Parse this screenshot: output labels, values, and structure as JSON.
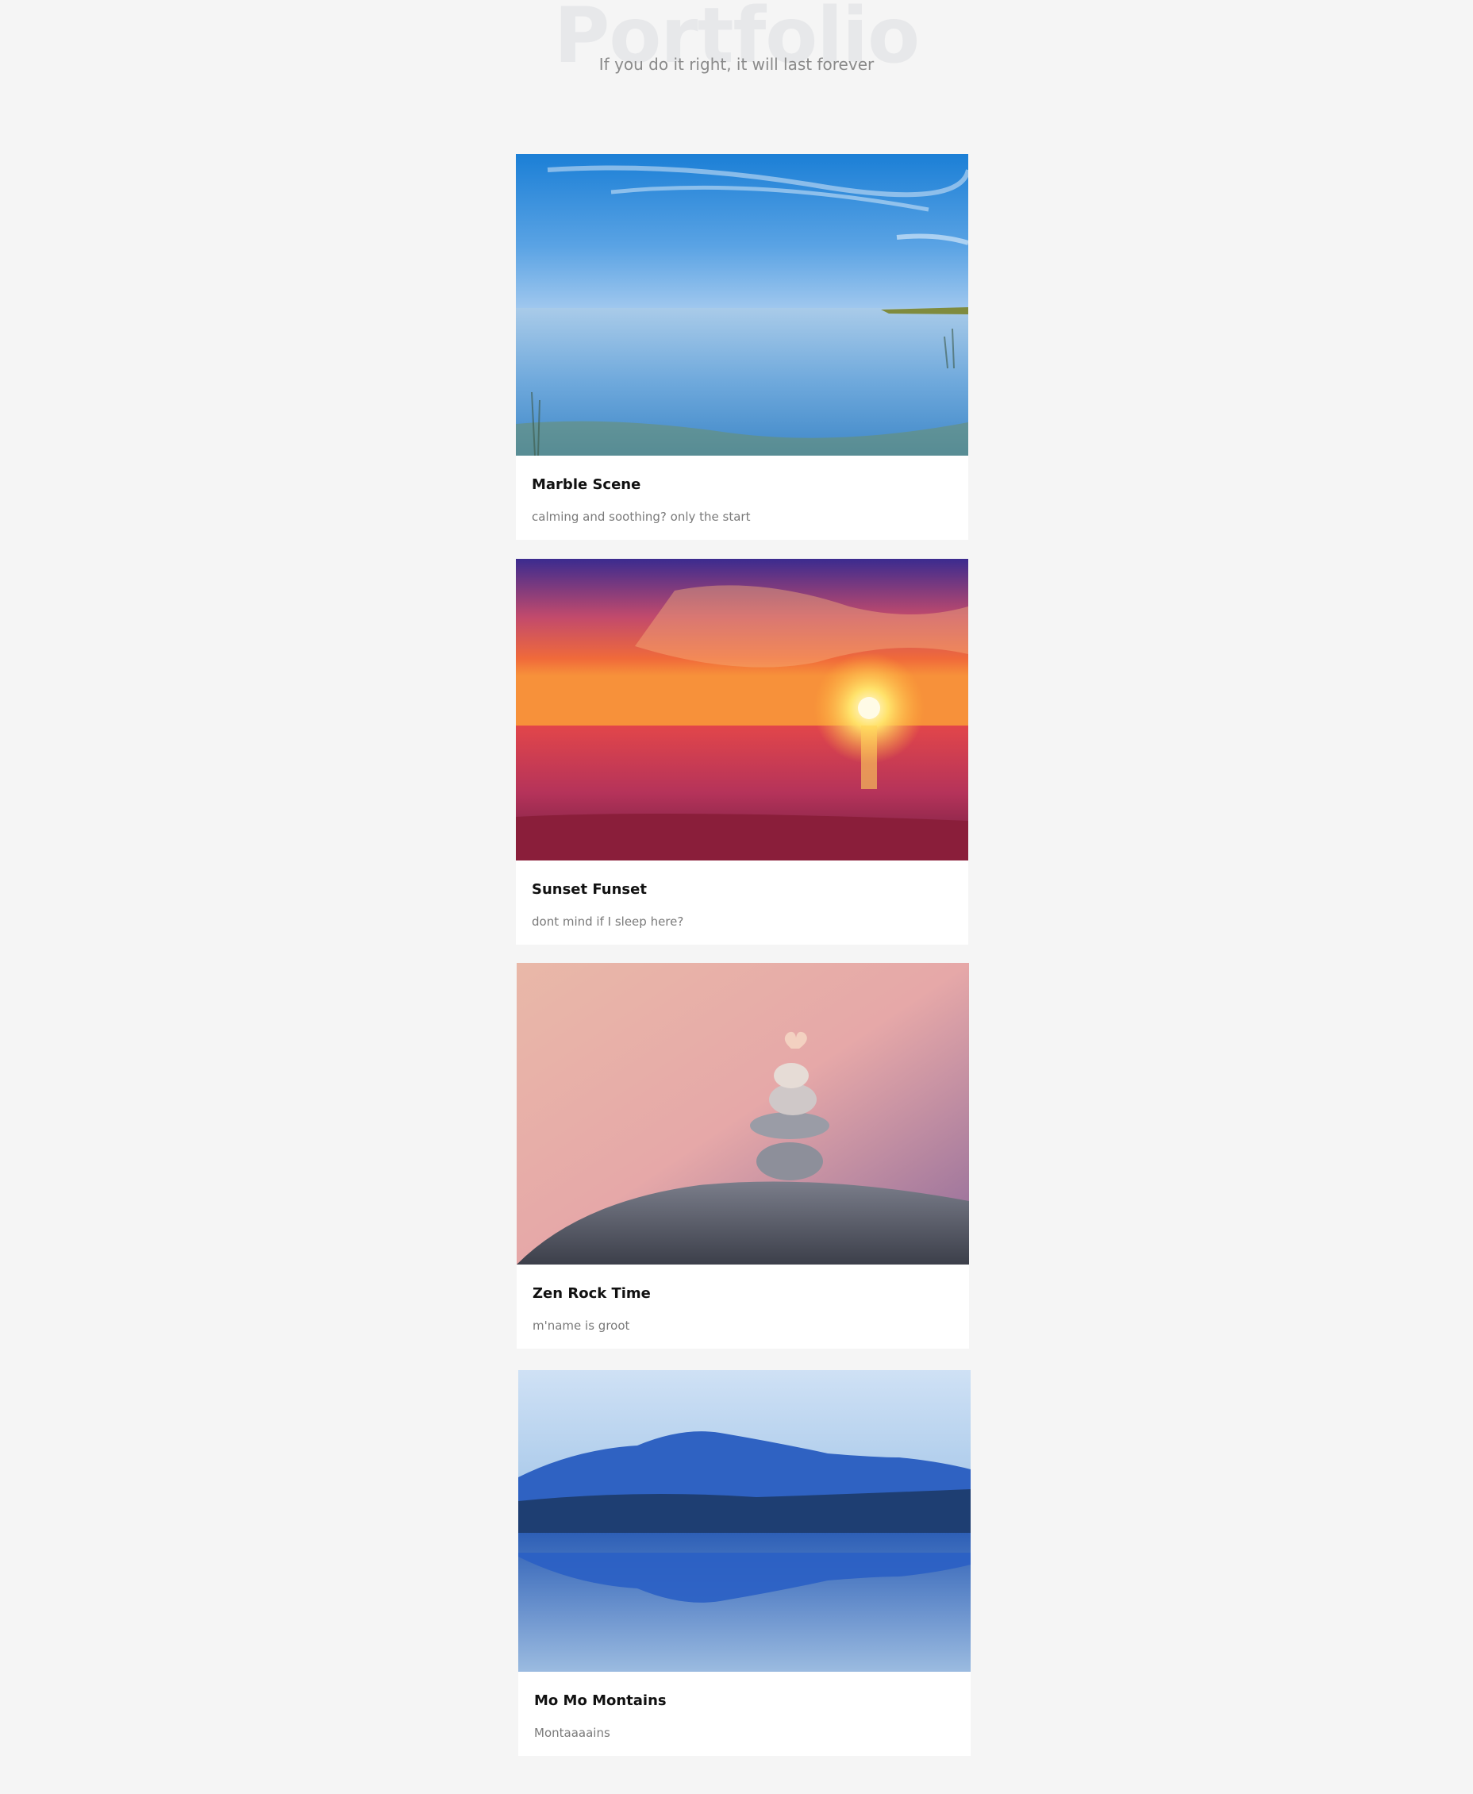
{
  "header": {
    "watermark": "Portfolio",
    "tagline": "If you do it right, it will last forever"
  },
  "cards": [
    {
      "title": "Marble Scene",
      "description": "calming and soothing? only the start",
      "image": "calm-sea-photo"
    },
    {
      "title": "Sunset Funset",
      "description": "dont mind if I sleep here?",
      "image": "sunset-over-sea-photo"
    },
    {
      "title": "Zen Rock Time",
      "description": "m'name is groot",
      "image": "stacked-zen-stones-photo"
    },
    {
      "title": "Mo Mo Montains",
      "description": "Montaaaains",
      "image": "mountain-lake-reflection-photo"
    }
  ],
  "colors": {
    "background": "#f5f5f5",
    "card": "#ffffff",
    "title": "#111111",
    "description": "#7a7a7a",
    "watermark": "#e7e8ea"
  }
}
